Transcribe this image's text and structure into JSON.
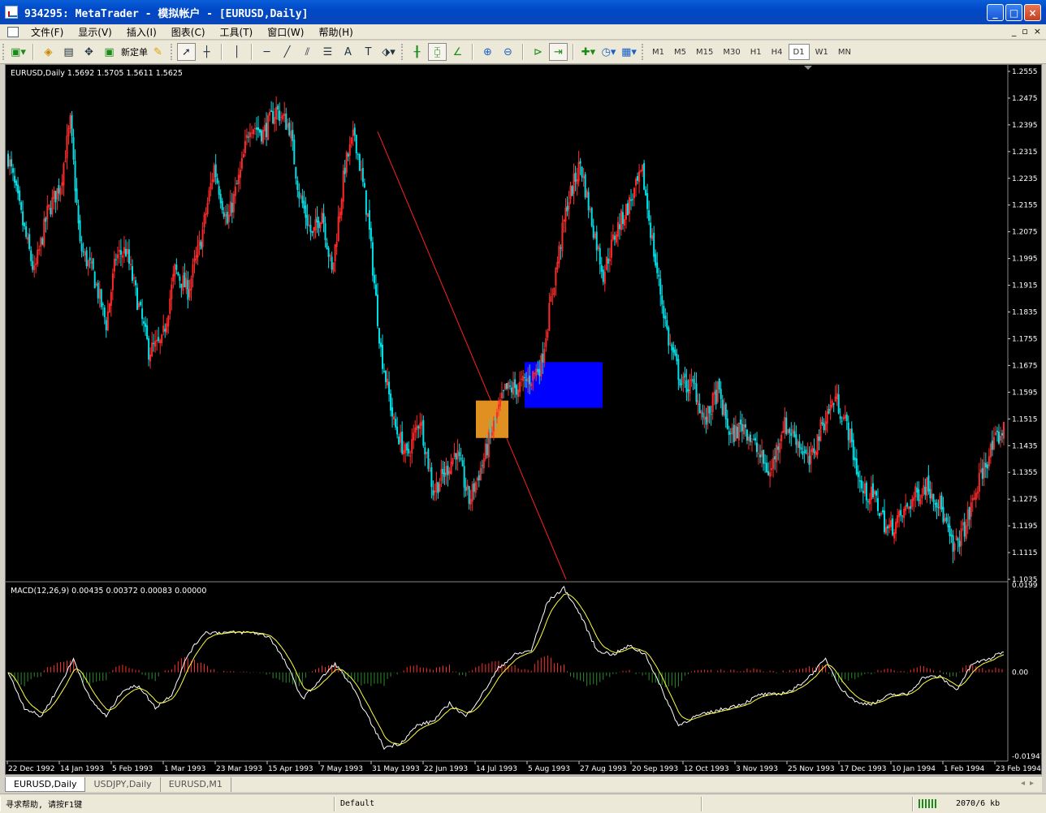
{
  "window": {
    "title": "934295: MetaTrader - 模拟帐户 - [EURUSD,Daily]",
    "minimize": "_",
    "maximize": "□",
    "close": "×"
  },
  "menu": {
    "items": [
      "文件(F)",
      "显示(V)",
      "插入(I)",
      "图表(C)",
      "工具(T)",
      "窗口(W)",
      "帮助(H)"
    ],
    "mdi": [
      "_",
      "▫",
      "×"
    ]
  },
  "toolbar": {
    "new_order_label": "新定单",
    "timeframes": [
      "M1",
      "M5",
      "M15",
      "M30",
      "H1",
      "H4",
      "D1",
      "W1",
      "MN"
    ],
    "active_timeframe": "D1"
  },
  "chart": {
    "header": "EURUSD,Daily  1.5692 1.5705 1.5611 1.5625",
    "price_labels": [
      "1.2555",
      "1.2475",
      "1.2395",
      "1.2315",
      "1.2235",
      "1.2155",
      "1.2075",
      "1.1995",
      "1.1915",
      "1.1835",
      "1.1755",
      "1.1675",
      "1.1595",
      "1.1515",
      "1.1435",
      "1.1355",
      "1.1275",
      "1.1195",
      "1.1115",
      "1.1035"
    ],
    "date_labels": [
      "22 Dec 1992",
      "14 Jan 1993",
      "5 Feb 1993",
      "1 Mar 1993",
      "23 Mar 1993",
      "15 Apr 1993",
      "7 May 1993",
      "31 May 1993",
      "22 Jun 1993",
      "14 Jul 1993",
      "5 Aug 1993",
      "27 Aug 1993",
      "20 Sep 1993",
      "12 Oct 1993",
      "3 Nov 1993",
      "25 Nov 1993",
      "17 Dec 1993",
      "10 Jan 1994",
      "1 Feb 1994",
      "23 Feb 1994"
    ],
    "macd_header": "MACD(12,26,9) 0.00435 0.00372 0.00083 0.00000",
    "macd_labels": [
      "0.0199",
      "0.00",
      "-0.01947"
    ],
    "colors": {
      "bull": "#ff2a2a",
      "bear": "#00e0e8",
      "bg": "#000000",
      "trendline": "#ff2020",
      "rect_orange": "#e09020",
      "rect_blue": "#0000ff",
      "macd_pos": "#ff3030",
      "macd_neg": "#2e8b2e",
      "macd_line": "#ffffff",
      "signal_line": "#ffff40"
    }
  },
  "chart_data": {
    "type": "candlestick",
    "symbol": "EURUSD",
    "timeframe": "Daily",
    "ylim": [
      1.1035,
      1.2555
    ],
    "close_path": [
      [
        0,
        1.23
      ],
      [
        8,
        1.212
      ],
      [
        16,
        1.195
      ],
      [
        24,
        1.213
      ],
      [
        32,
        1.222
      ],
      [
        38,
        1.24
      ],
      [
        44,
        1.203
      ],
      [
        52,
        1.195
      ],
      [
        60,
        1.18
      ],
      [
        66,
        1.2
      ],
      [
        72,
        1.202
      ],
      [
        80,
        1.185
      ],
      [
        86,
        1.172
      ],
      [
        94,
        1.174
      ],
      [
        102,
        1.196
      ],
      [
        110,
        1.19
      ],
      [
        118,
        1.205
      ],
      [
        126,
        1.227
      ],
      [
        134,
        1.21
      ],
      [
        142,
        1.225
      ],
      [
        148,
        1.24
      ],
      [
        156,
        1.237
      ],
      [
        164,
        1.244
      ],
      [
        172,
        1.239
      ],
      [
        178,
        1.219
      ],
      [
        186,
        1.206
      ],
      [
        192,
        1.214
      ],
      [
        198,
        1.195
      ],
      [
        206,
        1.227
      ],
      [
        212,
        1.237
      ],
      [
        220,
        1.212
      ],
      [
        228,
        1.172
      ],
      [
        236,
        1.15
      ],
      [
        244,
        1.14
      ],
      [
        252,
        1.152
      ],
      [
        260,
        1.13
      ],
      [
        268,
        1.136
      ],
      [
        274,
        1.142
      ],
      [
        282,
        1.127
      ],
      [
        290,
        1.138
      ],
      [
        296,
        1.148
      ],
      [
        304,
        1.16
      ],
      [
        312,
        1.161
      ],
      [
        320,
        1.164
      ],
      [
        326,
        1.168
      ],
      [
        334,
        1.193
      ],
      [
        342,
        1.216
      ],
      [
        350,
        1.228
      ],
      [
        356,
        1.213
      ],
      [
        364,
        1.195
      ],
      [
        372,
        1.208
      ],
      [
        380,
        1.216
      ],
      [
        388,
        1.225
      ],
      [
        396,
        1.198
      ],
      [
        404,
        1.175
      ],
      [
        412,
        1.162
      ],
      [
        420,
        1.161
      ],
      [
        426,
        1.15
      ],
      [
        434,
        1.16
      ],
      [
        442,
        1.146
      ],
      [
        450,
        1.15
      ],
      [
        458,
        1.142
      ],
      [
        466,
        1.135
      ],
      [
        474,
        1.15
      ],
      [
        482,
        1.146
      ],
      [
        490,
        1.138
      ],
      [
        498,
        1.15
      ],
      [
        506,
        1.158
      ],
      [
        514,
        1.148
      ],
      [
        522,
        1.13
      ],
      [
        530,
        1.128
      ],
      [
        538,
        1.118
      ],
      [
        546,
        1.122
      ],
      [
        554,
        1.128
      ],
      [
        562,
        1.132
      ],
      [
        570,
        1.126
      ],
      [
        578,
        1.112
      ],
      [
        586,
        1.12
      ],
      [
        594,
        1.133
      ],
      [
        600,
        1.141
      ],
      [
        608,
        1.148
      ]
    ],
    "trendline": {
      "from": [
        "31 May 1993",
        1.2375
      ],
      "to": [
        "~11 Aug 1993",
        1.1035
      ]
    },
    "rectangles": [
      {
        "color": "orange",
        "date_range": [
          "~10 Jul 1993",
          "~18 Jul 1993"
        ],
        "price_range": [
          1.1458,
          1.157
        ]
      },
      {
        "color": "blue",
        "date_range": [
          "~22 Jul 1993",
          "~14 Aug 1993"
        ],
        "price_range": [
          1.1548,
          1.1685
        ]
      }
    ],
    "macd": {
      "params": "12,26,9",
      "ylim": [
        -0.01947,
        0.0199
      ],
      "main_path": [
        [
          0,
          -0.0
        ],
        [
          10,
          -0.008
        ],
        [
          20,
          -0.01
        ],
        [
          30,
          -0.004
        ],
        [
          40,
          0.003
        ],
        [
          50,
          -0.006
        ],
        [
          60,
          -0.01
        ],
        [
          70,
          -0.004
        ],
        [
          80,
          -0.003
        ],
        [
          90,
          -0.008
        ],
        [
          100,
          -0.005
        ],
        [
          110,
          0.004
        ],
        [
          120,
          0.009
        ],
        [
          130,
          0.009
        ],
        [
          140,
          0.009
        ],
        [
          150,
          0.009
        ],
        [
          160,
          0.008
        ],
        [
          170,
          0.002
        ],
        [
          180,
          -0.006
        ],
        [
          190,
          -0.002
        ],
        [
          200,
          0.002
        ],
        [
          210,
          -0.003
        ],
        [
          220,
          -0.01
        ],
        [
          230,
          -0.017
        ],
        [
          240,
          -0.016
        ],
        [
          250,
          -0.012
        ],
        [
          260,
          -0.011
        ],
        [
          270,
          -0.007
        ],
        [
          280,
          -0.01
        ],
        [
          290,
          -0.005
        ],
        [
          300,
          0.001
        ],
        [
          310,
          0.004
        ],
        [
          320,
          0.005
        ],
        [
          330,
          0.016
        ],
        [
          340,
          0.019
        ],
        [
          350,
          0.013
        ],
        [
          360,
          0.005
        ],
        [
          370,
          0.004
        ],
        [
          380,
          0.006
        ],
        [
          390,
          0.004
        ],
        [
          400,
          -0.004
        ],
        [
          410,
          -0.012
        ],
        [
          420,
          -0.01
        ],
        [
          430,
          -0.009
        ],
        [
          440,
          -0.008
        ],
        [
          450,
          -0.007
        ],
        [
          460,
          -0.005
        ],
        [
          470,
          -0.005
        ],
        [
          480,
          -0.004
        ],
        [
          490,
          -0.001
        ],
        [
          500,
          0.003
        ],
        [
          510,
          -0.004
        ],
        [
          520,
          -0.007
        ],
        [
          530,
          -0.007
        ],
        [
          540,
          -0.005
        ],
        [
          550,
          -0.005
        ],
        [
          560,
          -0.001
        ],
        [
          570,
          -0.001
        ],
        [
          580,
          -0.004
        ],
        [
          590,
          0.002
        ],
        [
          600,
          0.003
        ],
        [
          610,
          0.005
        ]
      ]
    }
  },
  "tabs": [
    "EURUSD,Daily",
    "USDJPY,Daily",
    "EURUSD,M1"
  ],
  "status": {
    "help": "寻求帮助, 请按F1键",
    "profile": "Default",
    "traffic": "2070/6 kb"
  }
}
